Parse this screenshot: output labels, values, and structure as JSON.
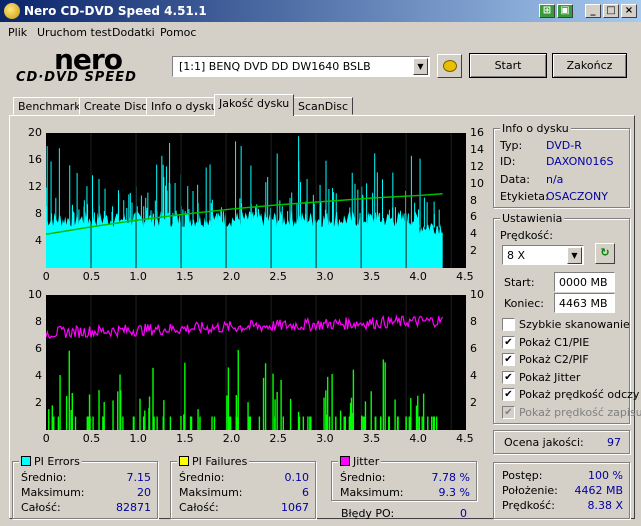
{
  "window": {
    "title": "Nero CD-DVD Speed 4.51.1"
  },
  "menu": [
    "Plik",
    "Uruchom test",
    "Dodatki",
    "Pomoc"
  ],
  "logo": {
    "brand": "nero",
    "product": "CD·DVD SPEED"
  },
  "drive": {
    "selected": "[1:1]  BENQ DVD DD DW1640 BSLB"
  },
  "buttons": {
    "start": "Start",
    "quit": "Zakończ"
  },
  "tabs": [
    "Benchmark",
    "Create Disc",
    "Info o dysku",
    "Jakość dysku",
    "ScanDisc"
  ],
  "active_tab": 3,
  "chart_top": {
    "left_ticks": [
      "20",
      "16",
      "12",
      "8",
      "4"
    ],
    "right_ticks": [
      "16",
      "14",
      "12",
      "10",
      "8",
      "6",
      "4",
      "2"
    ],
    "x_ticks": [
      "0",
      "0.5",
      "1.0",
      "1.5",
      "2.0",
      "2.5",
      "3.0",
      "3.5",
      "4.0",
      "4.5"
    ]
  },
  "chart_bottom": {
    "left_ticks": [
      "10",
      "8",
      "6",
      "4",
      "2"
    ],
    "right_ticks": [
      "10",
      "8",
      "6",
      "4",
      "2"
    ],
    "x_ticks": [
      "0",
      "0.5",
      "1.0",
      "1.5",
      "2.0",
      "2.5",
      "3.0",
      "3.5",
      "4.0",
      "4.5"
    ]
  },
  "chart_data": [
    {
      "type": "area",
      "title": "",
      "x_range": [
        0,
        4.5
      ],
      "y_range": [
        0,
        20
      ],
      "y2_range": [
        0,
        16
      ],
      "series": [
        {
          "name": "PI Errors",
          "color": "#00ffff",
          "average": 7.15,
          "max": 20
        },
        {
          "name": "",
          "color": "#00c000",
          "axis": "right",
          "x": [
            0,
            0.5,
            1.0,
            1.5,
            2.0,
            2.5,
            3.0,
            3.5,
            4.0,
            4.25
          ],
          "y": [
            4,
            4.9,
            5.7,
            6.4,
            7.0,
            7.5,
            7.9,
            8.3,
            8.6,
            8.8
          ]
        }
      ]
    },
    {
      "type": "bar",
      "title": "",
      "x_range": [
        0,
        4.5
      ],
      "y_range": [
        0,
        10
      ],
      "series": [
        {
          "name": "PI Failures",
          "color": "#00ff00",
          "average": 0.1,
          "max": 6
        },
        {
          "name": "Jitter",
          "color": "#ff00ff",
          "average": 7.78,
          "max": 9.3
        }
      ]
    }
  ],
  "info": {
    "heading": "Info o dysku",
    "rows": [
      {
        "label": "Typ:",
        "value": "DVD-R"
      },
      {
        "label": "ID:",
        "value": "DAXON016S"
      },
      {
        "label": "Data:",
        "value": "n/a"
      },
      {
        "label": "Etykieta:",
        "value": "OSACZONY"
      }
    ]
  },
  "settings": {
    "heading": "Ustawienia",
    "speed_label": "Prędkość:",
    "speed_value": "8 X",
    "start_label": "Start:",
    "start_value": "0000 MB",
    "end_label": "Koniec:",
    "end_value": "4463 MB",
    "checkboxes": [
      {
        "label": "Szybkie skanowanie",
        "checked": false,
        "disabled": false
      },
      {
        "label": "Pokaż C1/PIE",
        "checked": true,
        "disabled": false
      },
      {
        "label": "Pokaż C2/PIF",
        "checked": true,
        "disabled": false
      },
      {
        "label": "Pokaż Jitter",
        "checked": true,
        "disabled": false
      },
      {
        "label": "Pokaż prędkość odczy",
        "checked": true,
        "disabled": false
      },
      {
        "label": "Pokaż prędkość zapisu",
        "checked": true,
        "disabled": true
      }
    ]
  },
  "quality": {
    "label": "Ocena jakości:",
    "value": "97"
  },
  "pi_errors": {
    "heading": "PI Errors",
    "color": "#00ffff",
    "rows": [
      {
        "label": "Średnio:",
        "value": "7.15"
      },
      {
        "label": "Maksimum:",
        "value": "20"
      },
      {
        "label": "Całość:",
        "value": "82871"
      }
    ]
  },
  "pi_failures": {
    "heading": "PI Failures",
    "color": "#ffff00",
    "rows": [
      {
        "label": "Średnio:",
        "value": "0.10"
      },
      {
        "label": "Maksimum:",
        "value": "6"
      },
      {
        "label": "Całość:",
        "value": "1067"
      }
    ]
  },
  "jitter": {
    "heading": "Jitter",
    "color": "#ff00ff",
    "rows": [
      {
        "label": "Średnio:",
        "value": "7.78 %"
      },
      {
        "label": "Maksimum:",
        "value": "9.3 %"
      }
    ],
    "po_label": "Błędy PO:",
    "po_value": "0"
  },
  "progress": {
    "rows": [
      {
        "label": "Postęp:",
        "value": "100 %"
      },
      {
        "label": "Położenie:",
        "value": "4462 MB"
      },
      {
        "label": "Prędkość:",
        "value": "8.38 X"
      }
    ]
  }
}
